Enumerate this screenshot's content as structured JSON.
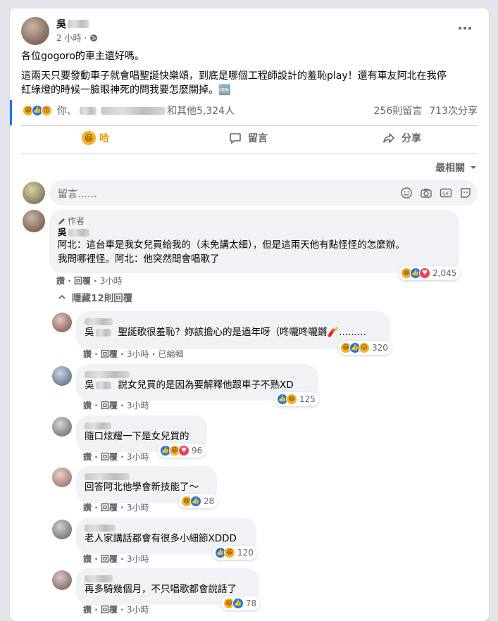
{
  "post": {
    "author": "吳",
    "time": "2 小時",
    "time_separator": "·",
    "text_line1": "各位gogoro的車主還好嗎。",
    "text_line2": "這兩天只要發動車子就會唱聖誕快樂頌，到底是哪個工程師設計的羞恥play！還有車友阿北在我停",
    "text_line3": "紅綠燈的時候一臉眼神死的問我要怎麼關掉。🆒",
    "reactions_text_prefix": "你、",
    "reactions_text_suffix": "和其他5,324人",
    "comments_count": "256則留言",
    "shares_count": "713次分享"
  },
  "actions": {
    "react_label": "哈",
    "comment_label": "留言",
    "share_label": "分享"
  },
  "sort": {
    "label": "最相關"
  },
  "composer": {
    "placeholder": "留言……"
  },
  "top_comment": {
    "badge": "作者",
    "author": "吳",
    "line1": "阿北：這台車是我女兒買給我的（未免講太細），但是這兩天他有點怪怪的怎麼辦。",
    "line2": "我問哪裡怪。阿北：他突然間會唱歌了",
    "reaction_count": "2,045",
    "like": "讚",
    "reply": "回覆",
    "time": "3小時",
    "hide_replies": "隱藏12則回覆"
  },
  "replies": [
    {
      "mention": "吳",
      "text": "聖誕歌很羞恥？妳該擔心的是過年呀（咚嚨咚嚨鏘🧨.........",
      "count": "320",
      "like": "讚",
      "reply": "回覆",
      "time": "3小時",
      "edited": "已編輯"
    },
    {
      "mention": "吳",
      "text": "說女兒買的是因為要解釋他跟車子不熟XD",
      "count": "125",
      "like": "讚",
      "reply": "回覆",
      "time": "3小時"
    },
    {
      "text": "隨口炫耀一下是女兒買的",
      "count": "96",
      "like": "讚",
      "reply": "回覆",
      "time": "3小時"
    },
    {
      "text": "回答阿北他學會新技能了～",
      "count": "28",
      "like": "讚",
      "reply": "回覆",
      "time": "3小時"
    },
    {
      "text": "老人家講話都會有很多小細節XDDD",
      "count": "120",
      "like": "讚",
      "reply": "回覆",
      "time": "3小時"
    },
    {
      "text": "再多騎幾個月，不只唱歌都會說話了",
      "count": "78",
      "like": "讚",
      "reply": "回覆",
      "time": "3小時"
    }
  ],
  "colors": {
    "accent": "#1877f2",
    "background": "#e4e6eb",
    "bubble": "#f0f2f5"
  }
}
